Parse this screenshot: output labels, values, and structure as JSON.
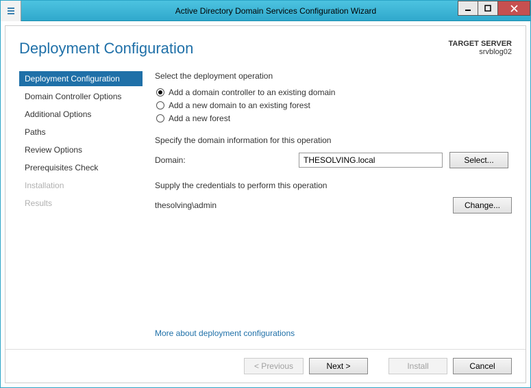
{
  "window": {
    "title": "Active Directory Domain Services Configuration Wizard"
  },
  "header": {
    "page_title": "Deployment Configuration",
    "target_label": "TARGET SERVER",
    "target_value": "srvblog02"
  },
  "sidebar": {
    "items": [
      {
        "label": "Deployment Configuration",
        "state": "active"
      },
      {
        "label": "Domain Controller Options",
        "state": "normal"
      },
      {
        "label": "Additional Options",
        "state": "normal"
      },
      {
        "label": "Paths",
        "state": "normal"
      },
      {
        "label": "Review Options",
        "state": "normal"
      },
      {
        "label": "Prerequisites Check",
        "state": "normal"
      },
      {
        "label": "Installation",
        "state": "disabled"
      },
      {
        "label": "Results",
        "state": "disabled"
      }
    ]
  },
  "main": {
    "op_label": "Select the deployment operation",
    "radios": [
      {
        "label": "Add a domain controller to an existing domain",
        "selected": true
      },
      {
        "label": "Add a new domain to an existing forest",
        "selected": false
      },
      {
        "label": "Add a new forest",
        "selected": false
      }
    ],
    "domain_section_label": "Specify the domain information for this operation",
    "domain_field_label": "Domain:",
    "domain_value": "THESOLVING.local",
    "select_btn": "Select...",
    "cred_section_label": "Supply the credentials to perform this operation",
    "cred_value": "thesolving\\admin",
    "change_btn": "Change...",
    "help_link": "More about deployment configurations"
  },
  "footer": {
    "previous": "< Previous",
    "next": "Next >",
    "install": "Install",
    "cancel": "Cancel"
  }
}
